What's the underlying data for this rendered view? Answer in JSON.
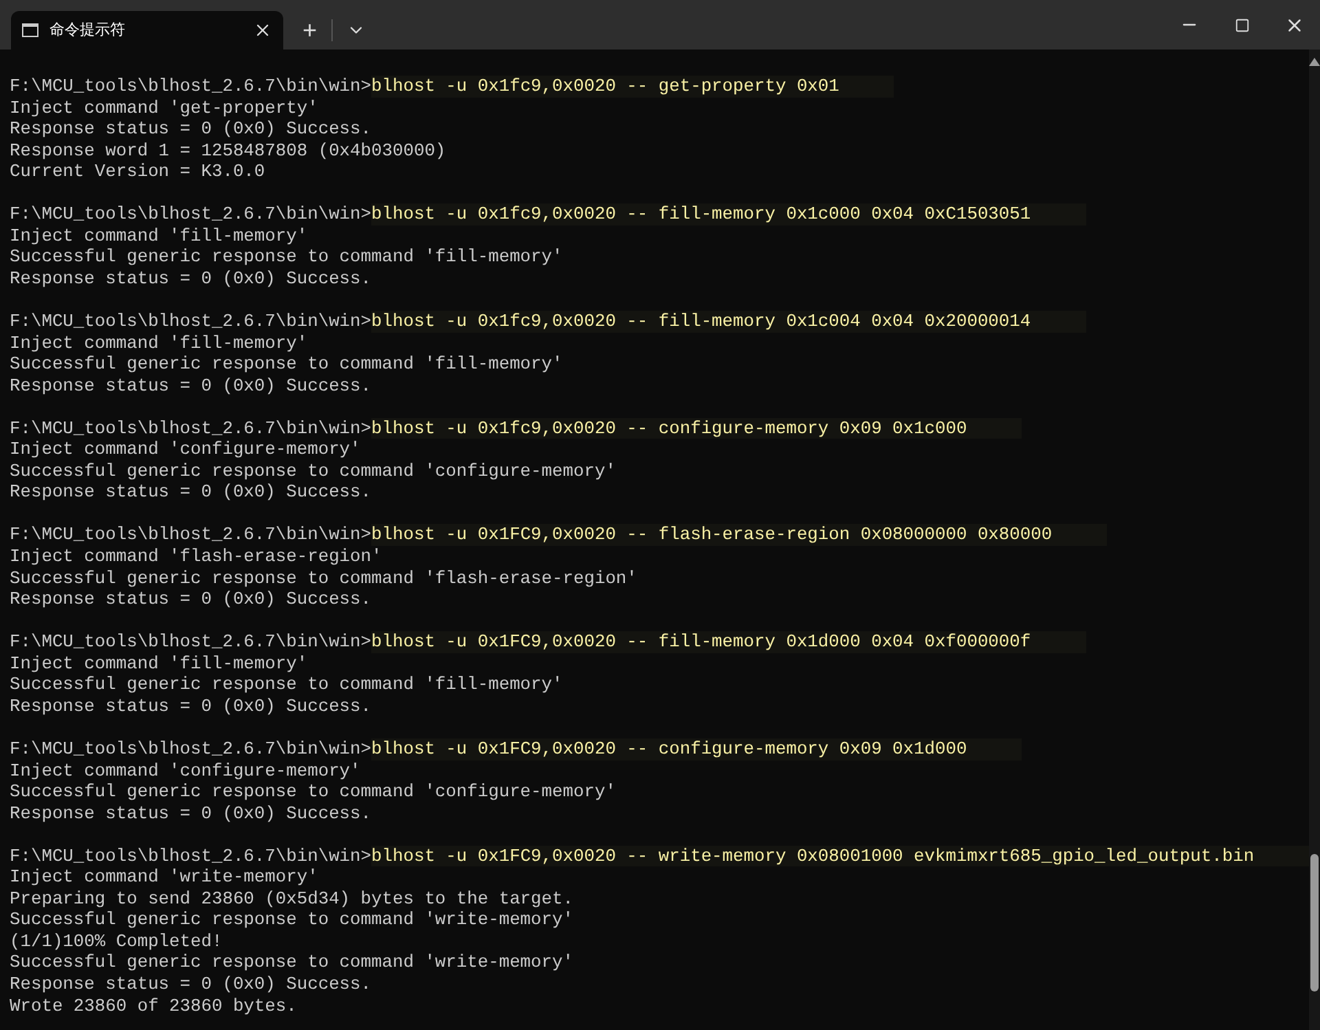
{
  "tabs": [
    {
      "title": "命令提示符",
      "selected": true
    }
  ],
  "new_tab_button": "+",
  "blocks": [
    {
      "prompt": "F:\\MCU_tools\\blhost_2.6.7\\bin\\win>",
      "command": "blhost -u 0x1fc9,0x0020 -- get-property 0x01",
      "output": [
        "Inject command 'get-property'",
        "Response status = 0 (0x0) Success.",
        "Response word 1 = 1258487808 (0x4b030000)",
        "Current Version = K3.0.0"
      ]
    },
    {
      "prompt": "F:\\MCU_tools\\blhost_2.6.7\\bin\\win>",
      "command": "blhost -u 0x1fc9,0x0020 -- fill-memory 0x1c000 0x04 0xC1503051",
      "output": [
        "Inject command 'fill-memory'",
        "Successful generic response to command 'fill-memory'",
        "Response status = 0 (0x0) Success."
      ]
    },
    {
      "prompt": "F:\\MCU_tools\\blhost_2.6.7\\bin\\win>",
      "command": "blhost -u 0x1fc9,0x0020 -- fill-memory 0x1c004 0x04 0x20000014",
      "output": [
        "Inject command 'fill-memory'",
        "Successful generic response to command 'fill-memory'",
        "Response status = 0 (0x0) Success."
      ]
    },
    {
      "prompt": "F:\\MCU_tools\\blhost_2.6.7\\bin\\win>",
      "command": "blhost -u 0x1fc9,0x0020 -- configure-memory 0x09 0x1c000",
      "output": [
        "Inject command 'configure-memory'",
        "Successful generic response to command 'configure-memory'",
        "Response status = 0 (0x0) Success."
      ]
    },
    {
      "prompt": "F:\\MCU_tools\\blhost_2.6.7\\bin\\win>",
      "command": "blhost -u 0x1FC9,0x0020 -- flash-erase-region 0x08000000 0x80000",
      "output": [
        "Inject command 'flash-erase-region'",
        "Successful generic response to command 'flash-erase-region'",
        "Response status = 0 (0x0) Success."
      ]
    },
    {
      "prompt": "F:\\MCU_tools\\blhost_2.6.7\\bin\\win>",
      "command": "blhost -u 0x1FC9,0x0020 -- fill-memory 0x1d000 0x04 0xf000000f",
      "output": [
        "Inject command 'fill-memory'",
        "Successful generic response to command 'fill-memory'",
        "Response status = 0 (0x0) Success."
      ]
    },
    {
      "prompt": "F:\\MCU_tools\\blhost_2.6.7\\bin\\win>",
      "command": "blhost -u 0x1FC9,0x0020 -- configure-memory 0x09 0x1d000",
      "output": [
        "Inject command 'configure-memory'",
        "Successful generic response to command 'configure-memory'",
        "Response status = 0 (0x0) Success."
      ]
    },
    {
      "prompt": "F:\\MCU_tools\\blhost_2.6.7\\bin\\win>",
      "command": "blhost -u 0x1FC9,0x0020 -- write-memory 0x08001000 evkmimxrt685_gpio_led_output.bin",
      "output": [
        "Inject command 'write-memory'",
        "Preparing to send 23860 (0x5d34) bytes to the target.",
        "Successful generic response to command 'write-memory'",
        "(1/1)100% Completed!",
        "Successful generic response to command 'write-memory'",
        "Response status = 0 (0x0) Success.",
        "Wrote 23860 of 23860 bytes."
      ]
    }
  ]
}
